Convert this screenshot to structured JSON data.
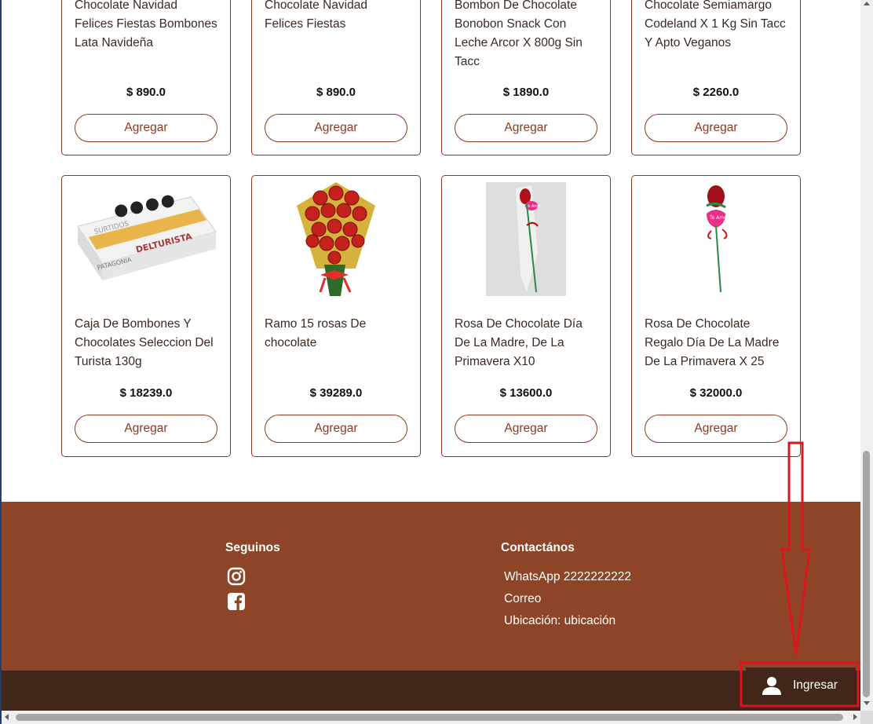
{
  "products_top_row": [
    {
      "title": "Chocolate Navidad Felices Fiestas Bombones Lata Navideña",
      "price": "$ 890.0",
      "button": "Agregar"
    },
    {
      "title": "Chocolate Navidad Felices Fiestas",
      "price": "$ 890.0",
      "button": "Agregar"
    },
    {
      "title": "Bombon De Chocolate Bonobon Snack Con Leche Arcor X 800g Sin Tacc",
      "price": "$ 1890.0",
      "button": "Agregar"
    },
    {
      "title": "Chocolate Semiamargo Codeland X 1 Kg Sin Tacc Y Apto Veganos",
      "price": "$ 2260.0",
      "button": "Agregar"
    }
  ],
  "products_bottom_row": [
    {
      "title": "Caja De Bombones Y Chocolates Seleccion Del Turista 130g",
      "price": "$ 18239.0",
      "button": "Agregar",
      "image_text": [
        "SURTIDOS",
        "DELTURISTA",
        "PATAGONIA"
      ]
    },
    {
      "title": "Ramo 15 rosas De chocolate",
      "price": "$ 39289.0",
      "button": "Agregar"
    },
    {
      "title": "Rosa De Chocolate Día De La Madre, De La Primavera X10",
      "price": "$ 13600.0",
      "button": "Agregar",
      "image_text": [
        "Te Amo"
      ]
    },
    {
      "title": "Rosa De Chocolate Regalo Día De La Madre De La Primavera X 25",
      "price": "$ 32000.0",
      "button": "Agregar",
      "image_text": [
        "Te Amo"
      ]
    }
  ],
  "footer": {
    "follow_title": "Seguinos",
    "social_icons": [
      "instagram-icon",
      "facebook-icon"
    ],
    "contact_title": "Contactános",
    "contact_lines": [
      "WhatsApp 2222222222",
      "Correo",
      "Ubicación: ubicación"
    ]
  },
  "login": {
    "label": "Ingresar",
    "icon": "user-icon"
  },
  "colors": {
    "brand_brown": "#8e4527",
    "dark_brown": "#43261a",
    "border": "#8b3a1f",
    "annotation_red": "#e0141e"
  }
}
